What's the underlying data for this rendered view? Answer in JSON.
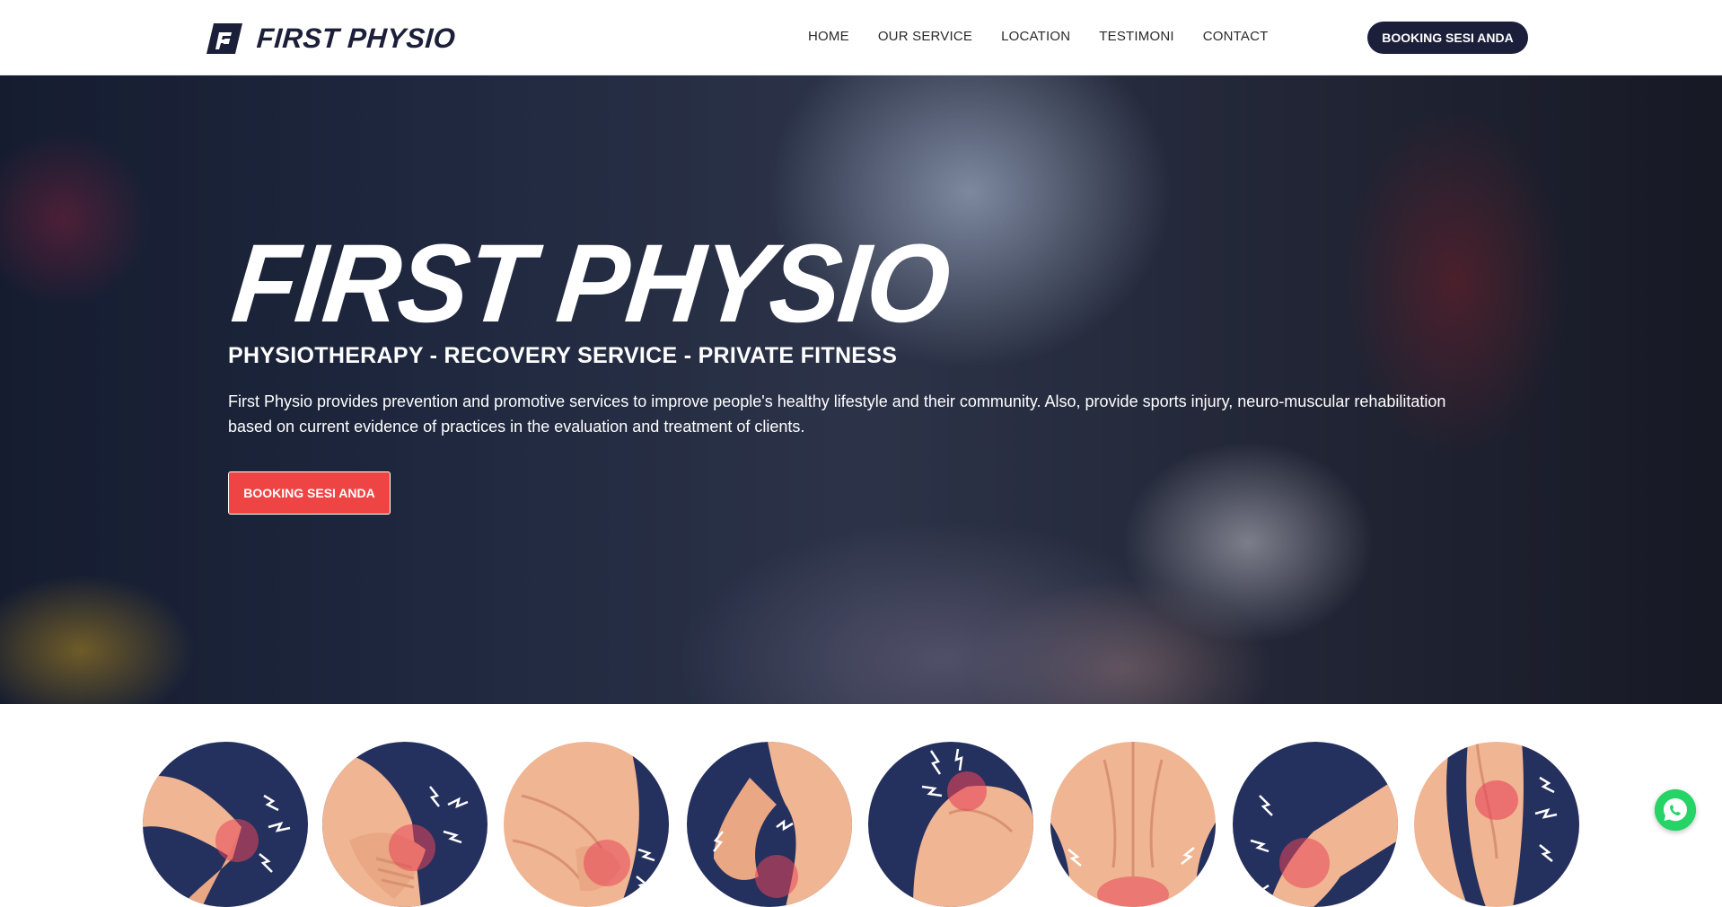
{
  "header": {
    "brand": "FIRST PHYSIO",
    "nav": [
      {
        "label": "HOME"
      },
      {
        "label": "OUR SERVICE"
      },
      {
        "label": "LOCATION"
      },
      {
        "label": "TESTIMONI"
      },
      {
        "label": "CONTACT"
      }
    ],
    "cta_label": "BOOKING SESI ANDA"
  },
  "hero": {
    "title": "FIRST PHYSIO",
    "subtitle": "PHYSIOTHERAPY - RECOVERY SERVICE - PRIVATE FITNESS",
    "description": "First Physio provides prevention and promotive services to improve people's healthy lifestyle and their community. Also, provide sports injury, neuro-muscular rehabilitation based on current evidence of practices in the evaluation and treatment of clients.",
    "cta_label": "BOOKING SESI ANDA"
  },
  "pain_areas": {
    "items": [
      {
        "icon": "elbow-pain-icon"
      },
      {
        "icon": "wrist-pain-icon"
      },
      {
        "icon": "hip-pain-icon"
      },
      {
        "icon": "side-pain-icon"
      },
      {
        "icon": "shoulder-pain-icon"
      },
      {
        "icon": "lower-back-pain-icon"
      },
      {
        "icon": "knee-pain-icon"
      },
      {
        "icon": "calf-pain-icon"
      }
    ]
  },
  "floating": {
    "icon": "whatsapp-icon"
  },
  "colors": {
    "navy": "#1c1f3a",
    "accent_red": "#ef4444",
    "icon_navy": "#24305e",
    "skin": "#f0b592",
    "pain": "#e8455a",
    "whatsapp": "#25d366"
  }
}
